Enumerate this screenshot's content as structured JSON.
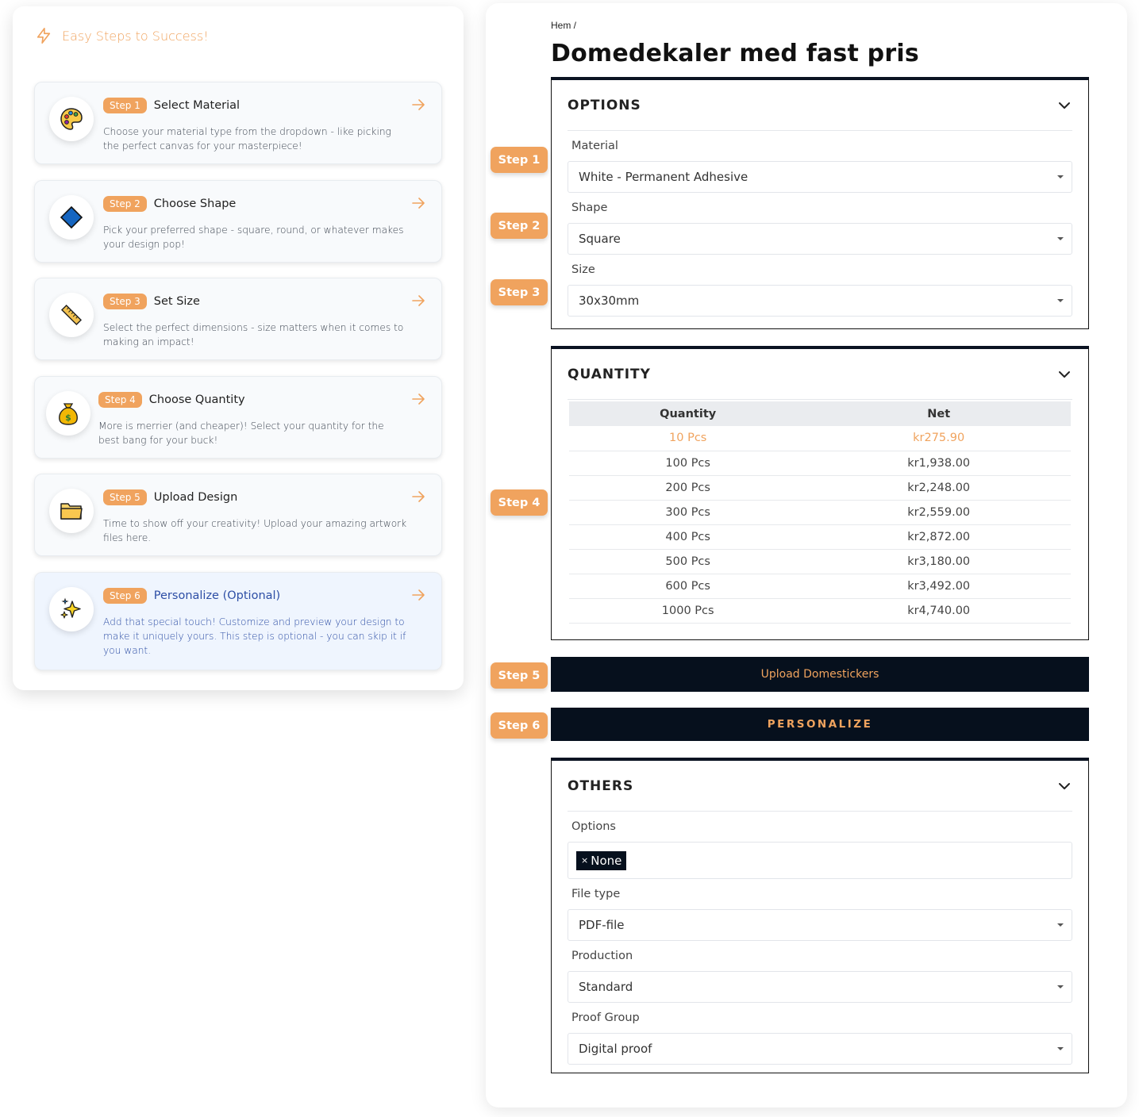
{
  "guide": {
    "title": "Easy Steps to Success!",
    "steps": [
      {
        "pill": "Step 1",
        "title": "Select Material",
        "desc": "Choose your material type from the dropdown - like picking the perfect canvas for your masterpiece!",
        "icon": "palette-icon"
      },
      {
        "pill": "Step 2",
        "title": "Choose Shape",
        "desc": "Pick your preferred shape - square, round, or whatever makes your design pop!",
        "icon": "diamond-icon"
      },
      {
        "pill": "Step 3",
        "title": "Set Size",
        "desc": "Select the perfect dimensions - size matters when it comes to making an impact!",
        "icon": "ruler-icon"
      },
      {
        "pill": "Step 4",
        "title": "Choose Quantity",
        "desc": "More is merrier (and cheaper)! Select your quantity for the best bang for your buck!",
        "icon": "money-bag-icon"
      },
      {
        "pill": "Step 5",
        "title": "Upload Design",
        "desc": "Time to show off your creativity! Upload your amazing artwork files here.",
        "icon": "folder-icon"
      },
      {
        "pill": "Step 6",
        "title": "Personalize (Optional)",
        "desc": "Add that special touch! Customize and preview your design to make it uniquely yours. This step is optional - you can skip it if you want.",
        "icon": "sparkles-icon"
      }
    ]
  },
  "product": {
    "breadcrumb": "Hem /",
    "title": "Domedekaler med fast pris",
    "options": {
      "title": "OPTIONS",
      "material_label": "Material",
      "material_value": "White - Permanent Adhesive",
      "shape_label": "Shape",
      "shape_value": "Square",
      "size_label": "Size",
      "size_value": "30x30mm"
    },
    "quantity": {
      "title": "QUANTITY",
      "col_qty": "Quantity",
      "col_net": "Net",
      "rows": [
        {
          "qty": "10 Pcs",
          "net": "kr275.90"
        },
        {
          "qty": "100 Pcs",
          "net": "kr1,938.00"
        },
        {
          "qty": "200 Pcs",
          "net": "kr2,248.00"
        },
        {
          "qty": "300 Pcs",
          "net": "kr2,559.00"
        },
        {
          "qty": "400 Pcs",
          "net": "kr2,872.00"
        },
        {
          "qty": "500 Pcs",
          "net": "kr3,180.00"
        },
        {
          "qty": "600 Pcs",
          "net": "kr3,492.00"
        },
        {
          "qty": "1000 Pcs",
          "net": "kr4,740.00"
        }
      ]
    },
    "upload_label": "Upload Domestickers",
    "personalize_label": "PERSONALIZE",
    "others": {
      "title": "OTHERS",
      "options_label": "Options",
      "options_tag_x": "×",
      "options_tag": "None",
      "filetype_label": "File type",
      "filetype_value": "PDF-file",
      "production_label": "Production",
      "production_value": "Standard",
      "proof_label": "Proof Group",
      "proof_value": "Digital proof"
    },
    "step_markers": [
      "Step 1",
      "Step 2",
      "Step 3",
      "Step 4",
      "Step 5",
      "Step 6"
    ]
  },
  "colors": {
    "accent": "#f0a35e",
    "dark": "#06101d",
    "active_text": "#2d4ea5"
  }
}
